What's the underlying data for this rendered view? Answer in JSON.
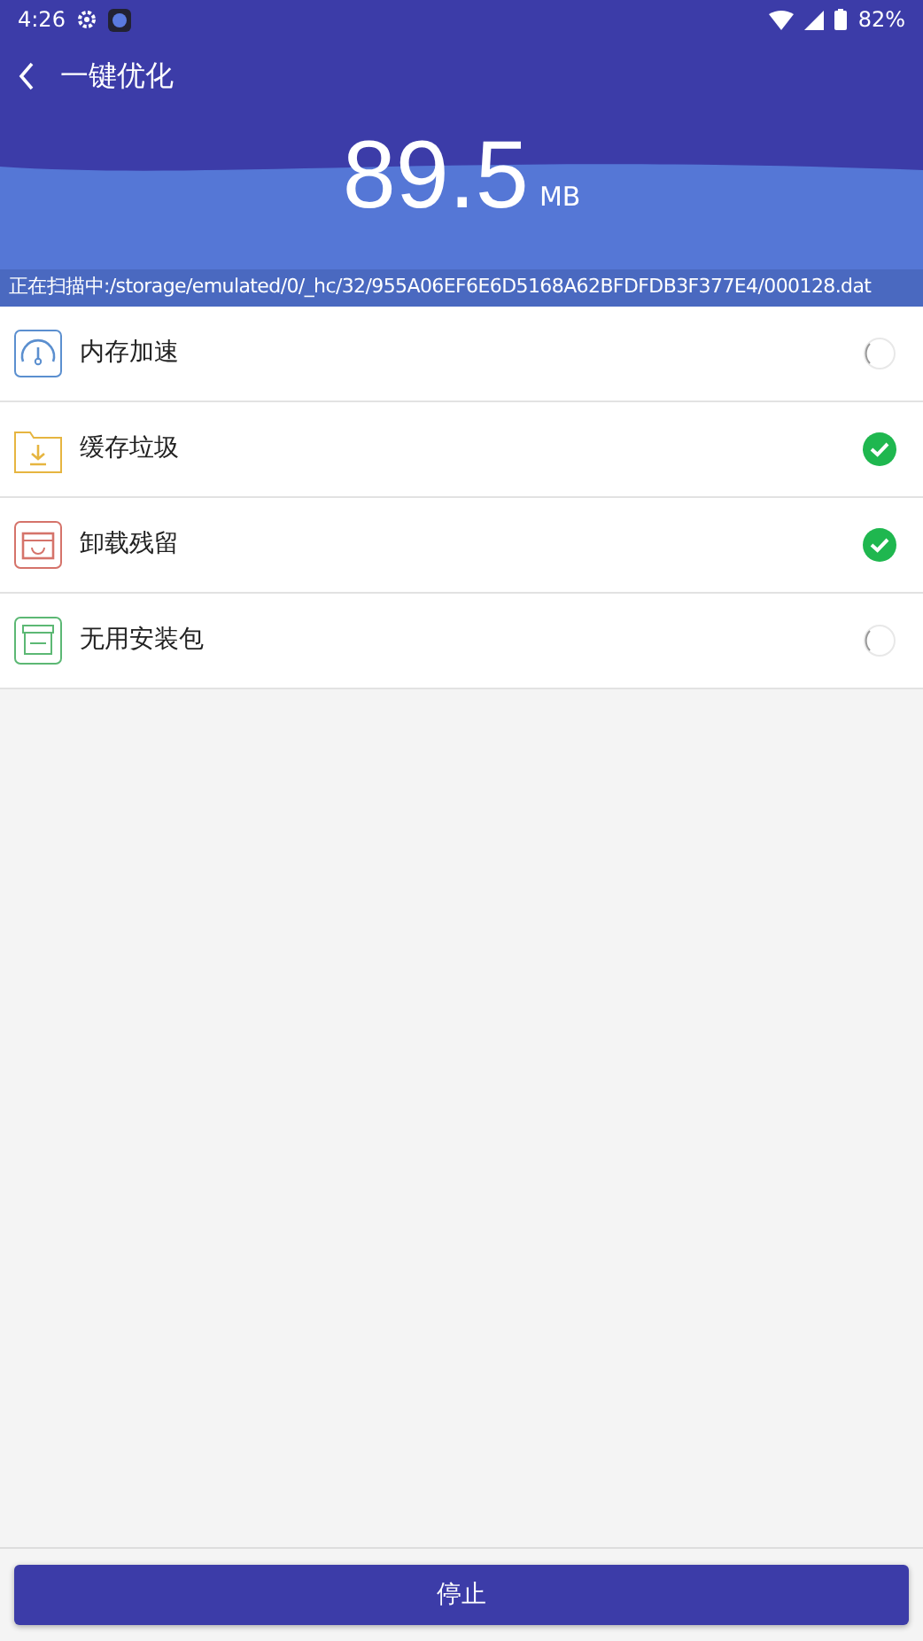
{
  "status_bar": {
    "time": "4:26",
    "battery": "82%"
  },
  "header": {
    "title": "一键优化",
    "size": "89.5",
    "unit": "MB"
  },
  "scan_path": "正在扫描中:/storage/emulated/0/_hc/32/955A06EF6E6D5168A62BFDFDB3F377E4/000128.dat",
  "items": [
    {
      "kind": "speed",
      "label": "内存加速",
      "done": false
    },
    {
      "kind": "cache",
      "label": "缓存垃圾",
      "done": true
    },
    {
      "kind": "residue",
      "label": "卸载残留",
      "done": true
    },
    {
      "kind": "apk",
      "label": "无用安装包",
      "done": false
    }
  ],
  "button": "停止"
}
